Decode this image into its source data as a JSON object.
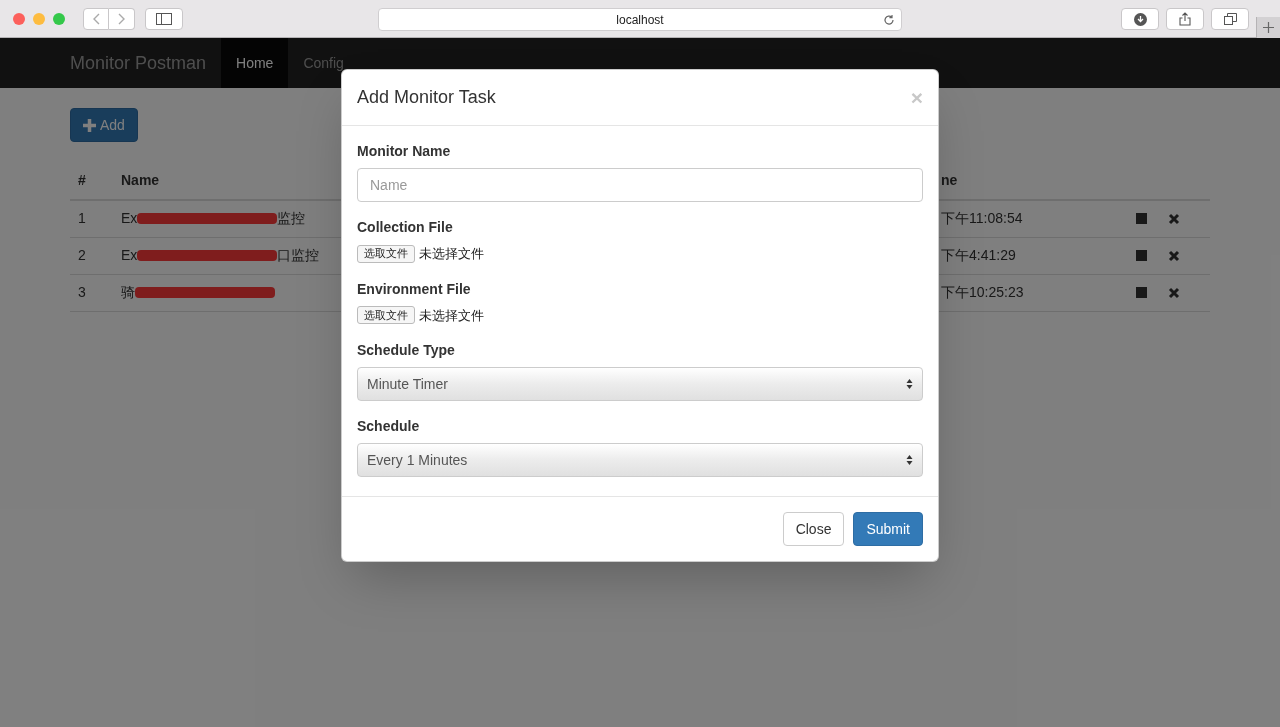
{
  "browser": {
    "address": "localhost"
  },
  "navbar": {
    "brand": "Monitor Postman",
    "items": [
      {
        "label": "Home",
        "selected": true
      },
      {
        "label": "Config",
        "selected": false
      }
    ]
  },
  "add_button": {
    "label": "Add"
  },
  "table": {
    "columns": [
      "#",
      "Name",
      "ne"
    ],
    "rows": [
      {
        "index": "1",
        "name_start": "Ex",
        "name_end": "监控",
        "time": "下午11:08:54"
      },
      {
        "index": "2",
        "name_start": "Ex",
        "name_end": "口监控",
        "time": "下午4:41:29"
      },
      {
        "index": "3",
        "name_start": "骑",
        "name_end": "",
        "time": "下午10:25:23"
      }
    ]
  },
  "modal": {
    "title": "Add Monitor Task",
    "close": "×",
    "fields": [
      {
        "kind": "text",
        "label": "Monitor Name",
        "placeholder": "Name"
      },
      {
        "kind": "file",
        "label": "Collection File",
        "button": "选取文件",
        "status": "未选择文件"
      },
      {
        "kind": "file",
        "label": "Environment File",
        "button": "选取文件",
        "status": "未选择文件"
      },
      {
        "kind": "select",
        "label": "Schedule Type",
        "value": "Minute Timer"
      },
      {
        "kind": "select",
        "label": "Schedule",
        "value": "Every 1 Minutes"
      }
    ],
    "buttons": [
      {
        "label": "Close",
        "kind": "default"
      },
      {
        "label": "Submit",
        "kind": "primary"
      }
    ]
  }
}
